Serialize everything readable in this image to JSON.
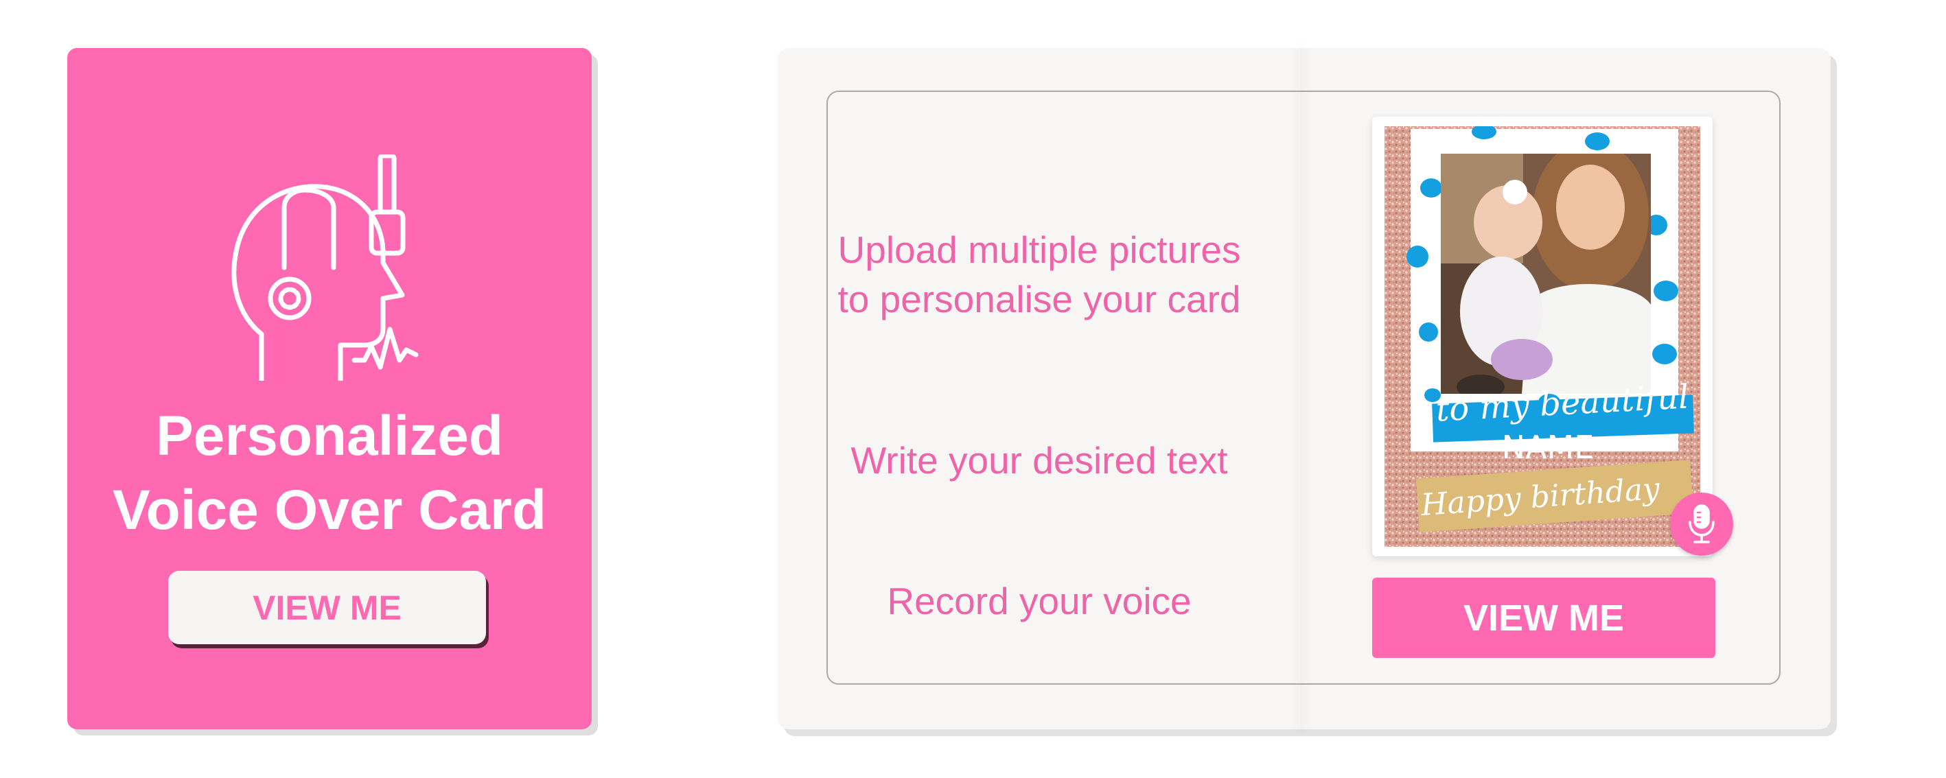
{
  "voice_card": {
    "title_line1": "Personalized",
    "title_line2": "Voice Over Card",
    "button_label": "VIEW ME",
    "icon": "headset-voice-icon"
  },
  "features": {
    "steps": [
      {
        "line1": "Upload multiple pictures",
        "line2": "to personalise your card"
      },
      {
        "line1": "Write your desired text"
      },
      {
        "line1": "Record your voice"
      }
    ],
    "preview": {
      "caption_line1": "to my beautiful",
      "caption_line2": "NAME",
      "caption_line3": "Happy birthday"
    },
    "mic_icon": "microphone-icon",
    "button_label": "VIEW ME"
  },
  "colors": {
    "brand_pink": "#ff69b1",
    "text_pink": "#ef63a8",
    "polka_blue": "#139fe0",
    "kraft_tape": "#dcba78",
    "glitter": "#d9a090"
  }
}
